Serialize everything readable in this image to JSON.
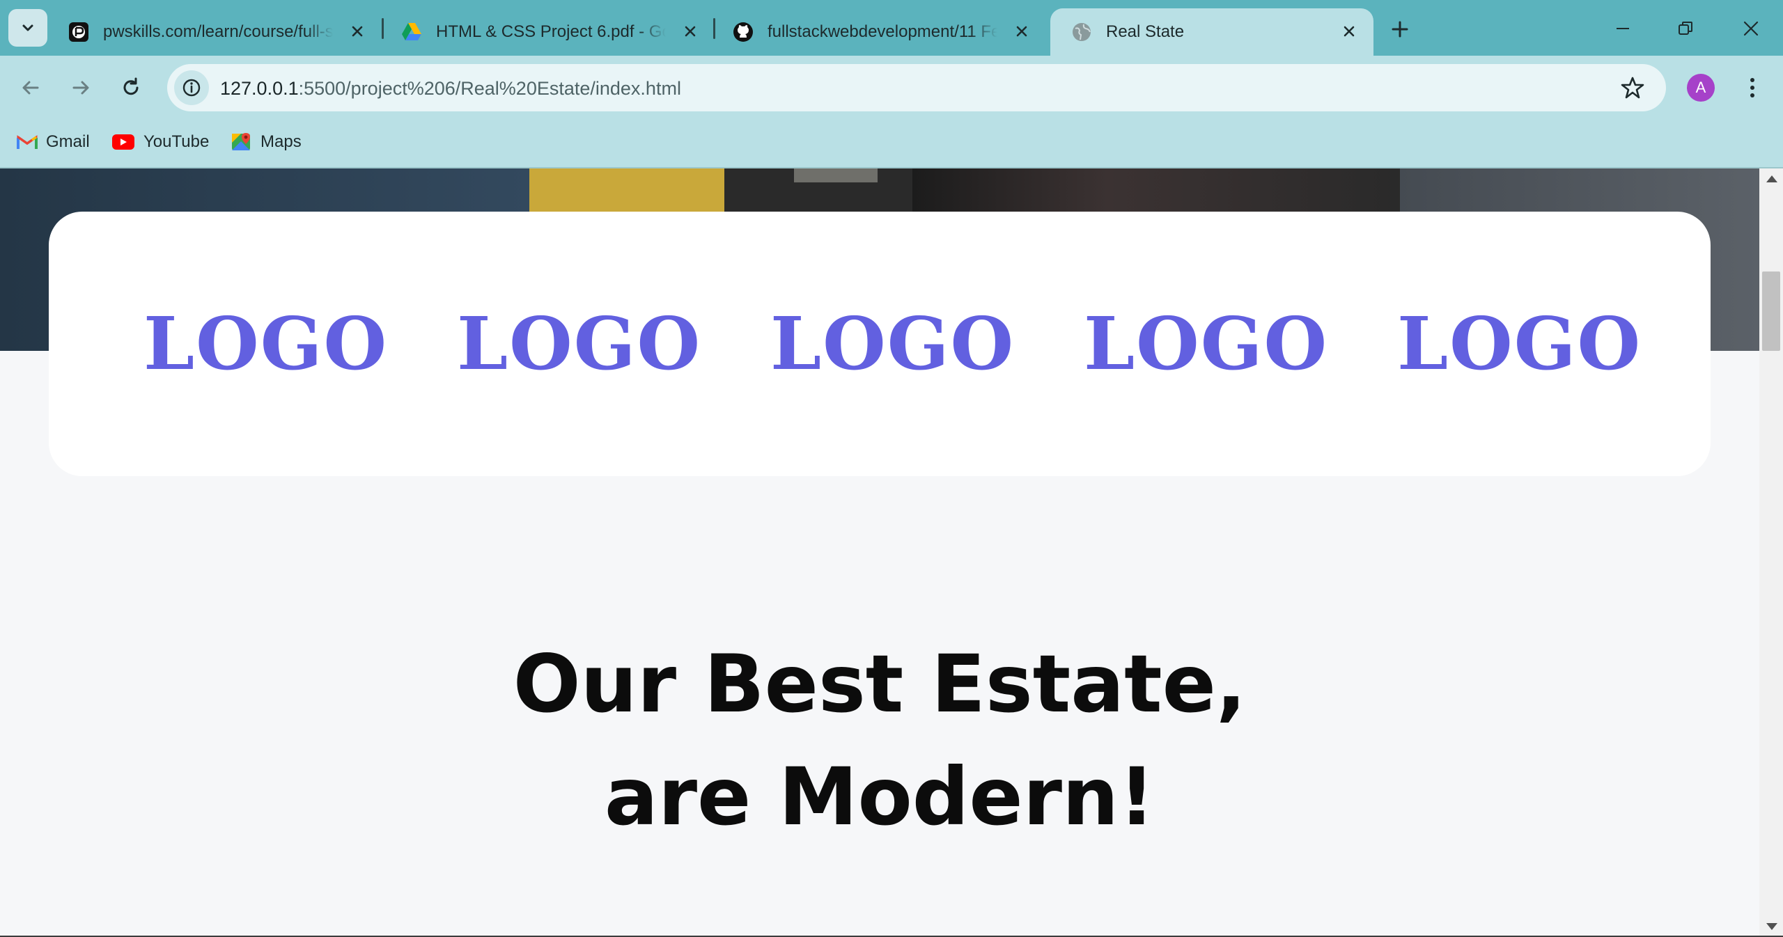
{
  "browser": {
    "tabs": [
      {
        "title": "pwskills.com/learn/course/full-s",
        "icon": "pwskills-favicon",
        "active": false
      },
      {
        "title": "HTML & CSS Project 6.pdf - Go",
        "icon": "google-drive-icon",
        "active": false
      },
      {
        "title": "fullstackwebdevelopment/11 Fe",
        "icon": "github-icon",
        "active": false
      },
      {
        "title": "Real State",
        "icon": "globe-icon",
        "active": true
      }
    ],
    "address": {
      "host": "127.0.0.1",
      "rest": ":5500/project%206/Real%20Estate/index.html"
    },
    "profile_initial": "A",
    "bookmarks": [
      {
        "label": "Gmail",
        "icon": "gmail-icon"
      },
      {
        "label": "YouTube",
        "icon": "youtube-icon"
      },
      {
        "label": "Maps",
        "icon": "maps-icon"
      }
    ],
    "colors": {
      "tabstrip": "#5bb3bd",
      "toolbar": "#b9e0e5",
      "avatar": "#a641c9"
    }
  },
  "page": {
    "logos": [
      "LOGO",
      "LOGO",
      "LOGO",
      "LOGO",
      "LOGO"
    ],
    "headline_line1": "Our Best Estate,",
    "headline_line2": "are Modern!",
    "colors": {
      "logo": "#6260e0",
      "background": "#f6f7f9"
    }
  }
}
